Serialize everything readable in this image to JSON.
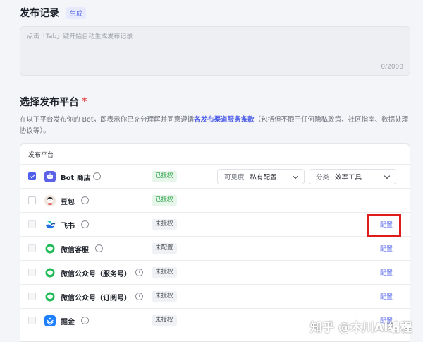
{
  "release_record": {
    "title": "发布记录",
    "generate_badge": "生成",
    "placeholder": "点击「Tab」键开始自动生成发布记录",
    "counter": "0/2000"
  },
  "platform_section": {
    "title": "选择发布平台",
    "required_mark": "*",
    "desc_prefix": "在以下平台发布你的 Bot，即表示你已充分理解并同意遵循",
    "desc_link": "各发布渠道服务条款",
    "desc_suffix": "（包括但不限于任何隐私政策、社区指南、数据处理协议等）。",
    "table_header": "发布平台"
  },
  "platforms": [
    {
      "name": "Bot 商店",
      "status": "已授权",
      "status_type": "auth",
      "checked": true,
      "visibility_label": "可见度",
      "visibility_value": "私有配置",
      "category_label": "分类",
      "category_value": "效率工具"
    },
    {
      "name": "豆包",
      "status": "已授权",
      "status_type": "auth",
      "checked": false
    },
    {
      "name": "飞书",
      "status": "未授权",
      "status_type": "noauth",
      "checked": false,
      "action": "配置"
    },
    {
      "name": "微信客服",
      "status": "未配置",
      "status_type": "noauth",
      "checked": false,
      "action": "配置"
    },
    {
      "name": "微信公众号（服务号）",
      "status": "未授权",
      "status_type": "noauth",
      "checked": false,
      "action": "配置"
    },
    {
      "name": "微信公众号（订阅号）",
      "status": "未授权",
      "status_type": "noauth",
      "checked": false,
      "action": "配置"
    },
    {
      "name": "掘金",
      "status": "未授权",
      "status_type": "noauth",
      "checked": false,
      "action": "配置"
    }
  ],
  "watermark": "知乎 @木川AI编程",
  "colors": {
    "accent": "#4e5ee8",
    "authorized": "#1f9d3d",
    "highlight": "#e01b1b"
  }
}
